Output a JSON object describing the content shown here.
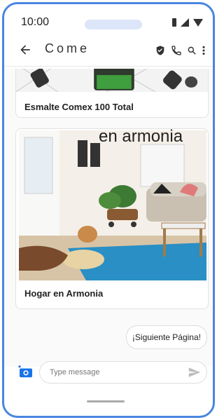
{
  "status_bar": {
    "time": "10:00"
  },
  "toolbar": {
    "title": "Come",
    "icons": [
      "back-arrow-icon",
      "verified-shield-icon",
      "phone-icon",
      "search-icon",
      "more-vert-icon"
    ]
  },
  "messages": {
    "card1": {
      "caption": "Esmalte Comex 100 Total"
    },
    "card2": {
      "caption": "Hogar en Armonia",
      "image_heading": "en armonia"
    },
    "suggestion": {
      "label": "¡Siguiente Página!"
    }
  },
  "composer": {
    "placeholder": "Type message",
    "icons": [
      "add-photo-icon",
      "send-icon"
    ]
  },
  "colors": {
    "frame": "#4a86e0",
    "accent": "#1a73e8",
    "rug": "#2a8fc4"
  }
}
